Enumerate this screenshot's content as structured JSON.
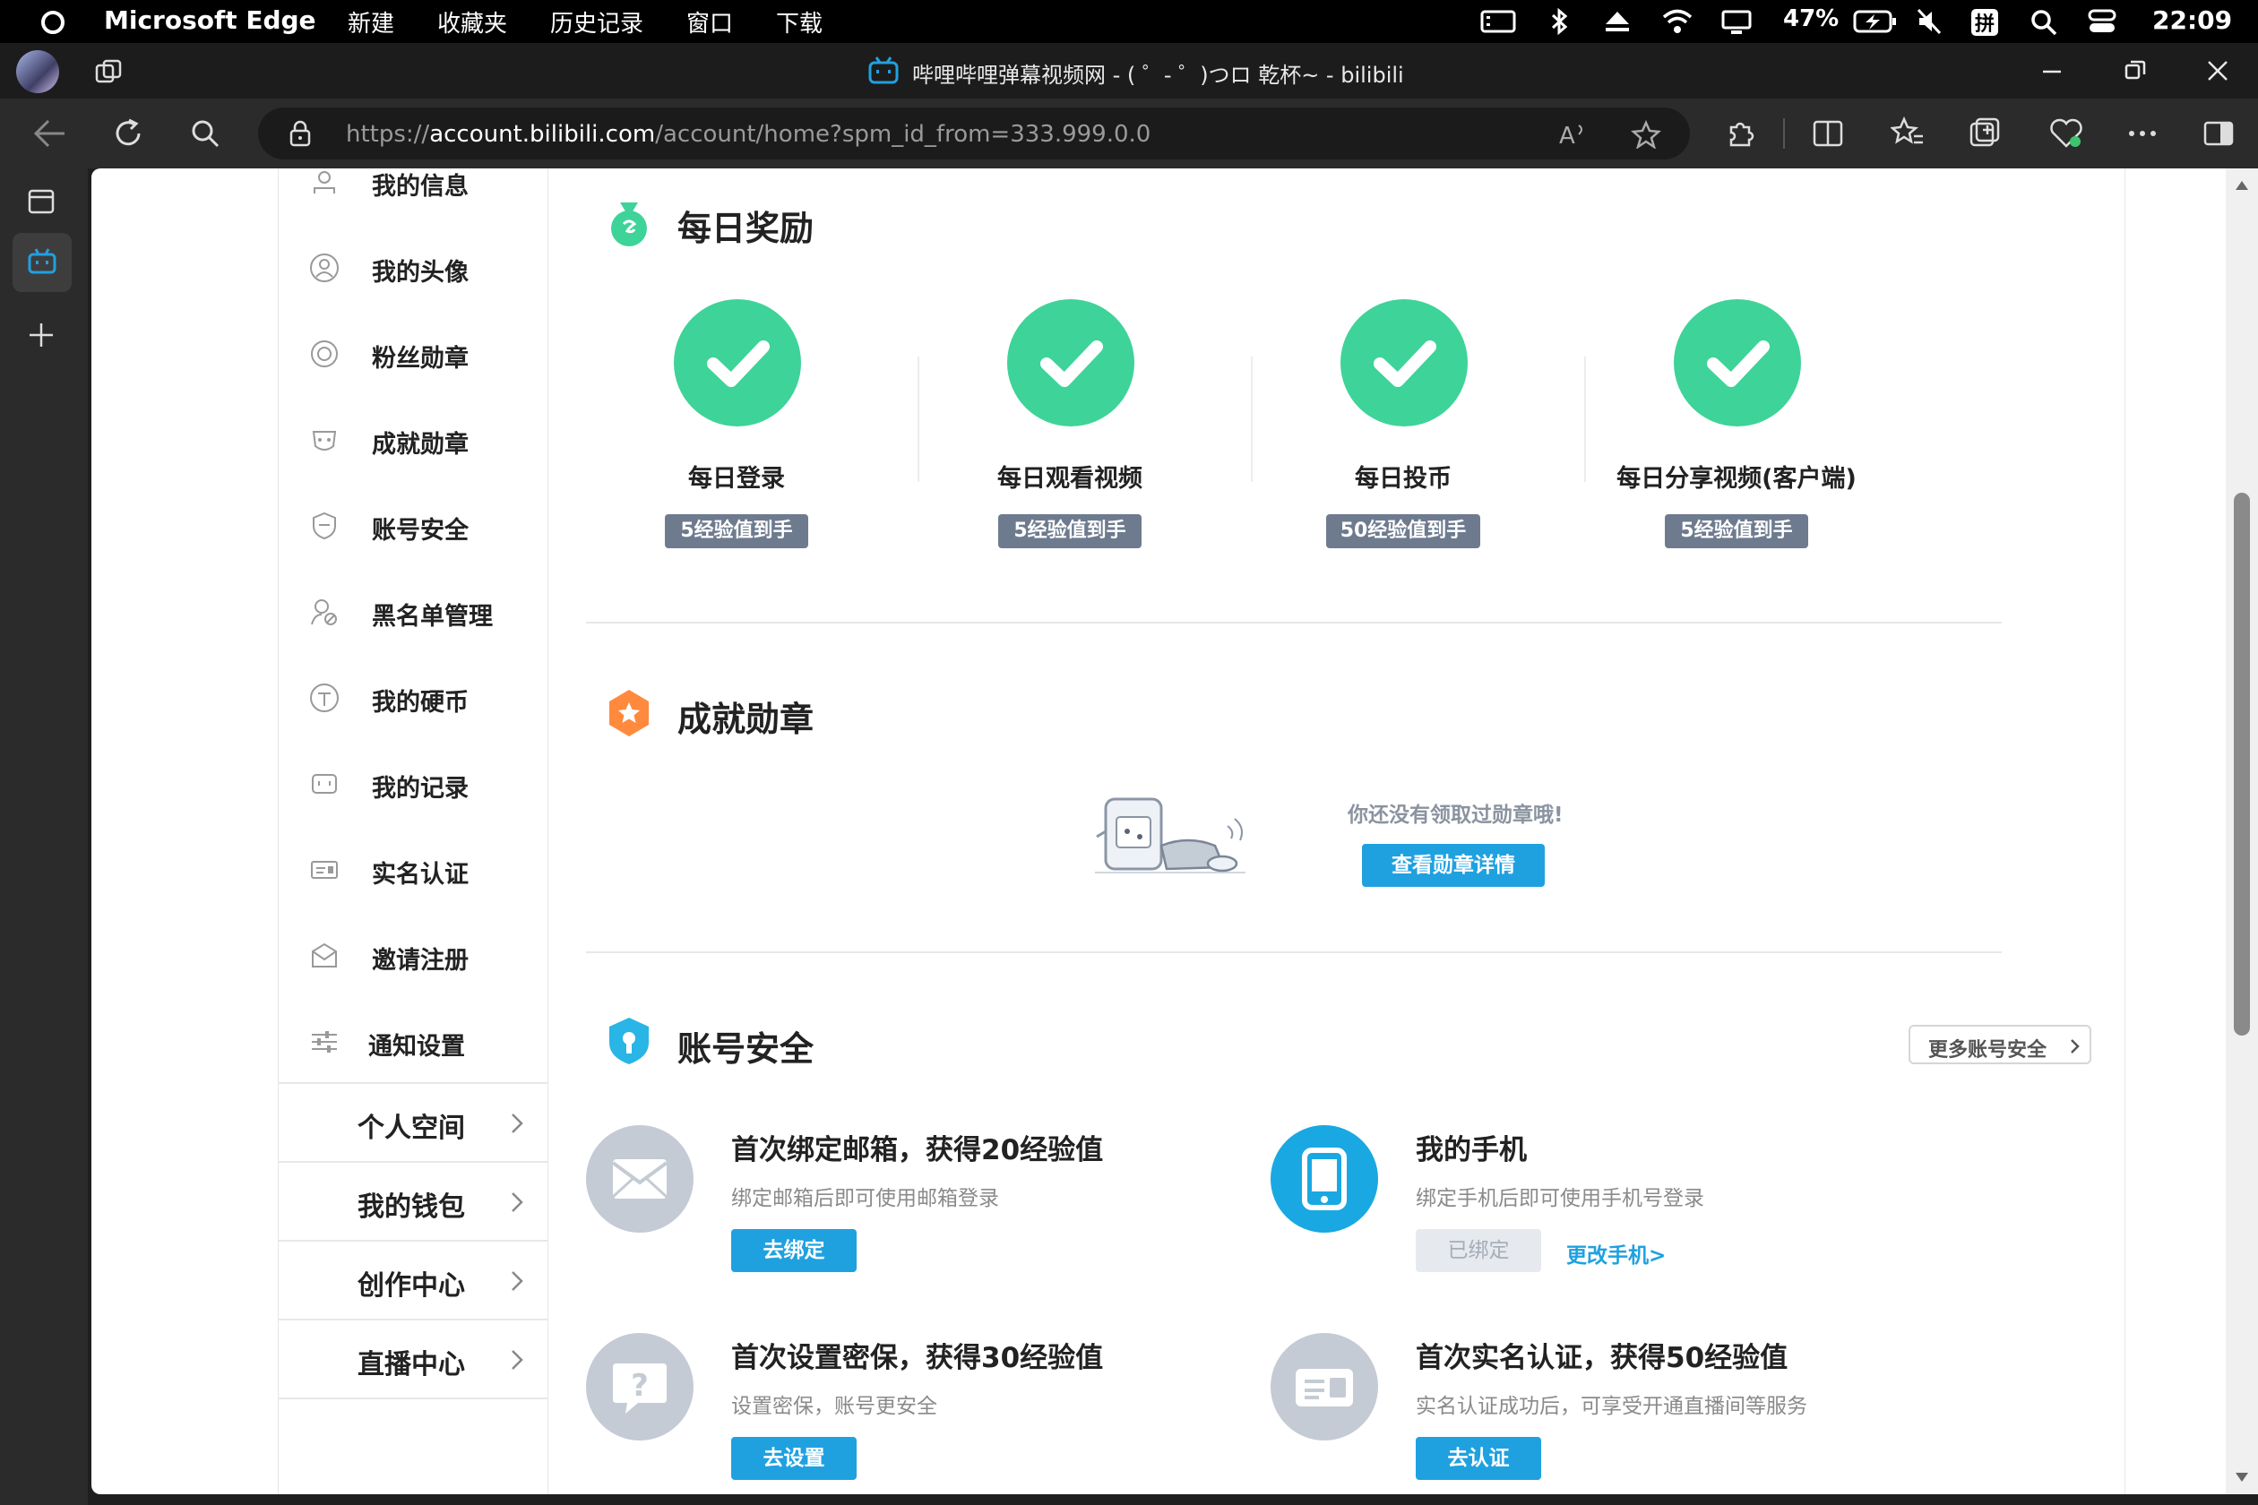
{
  "menubar": {
    "app_name": "Microsoft Edge",
    "items": [
      "新建",
      "收藏夹",
      "历史记录",
      "窗口",
      "下载"
    ],
    "battery": "47%",
    "time": "22:09"
  },
  "window": {
    "tab_title": "哔哩哔哩弹幕视频网 - ( ゜- ゜)つロ 乾杯~ - bilibili"
  },
  "address": {
    "url_prefix": "https://",
    "url_host": "account.bilibili.com",
    "url_path": "/account/home?spm_id_from=333.999.0.0"
  },
  "sidebar": {
    "items": [
      {
        "label": "我的信息",
        "icon": "user-info-icon"
      },
      {
        "label": "我的头像",
        "icon": "avatar-icon"
      },
      {
        "label": "粉丝勋章",
        "icon": "fan-medal-icon"
      },
      {
        "label": "成就勋章",
        "icon": "achievement-icon"
      },
      {
        "label": "账号安全",
        "icon": "shield-icon"
      },
      {
        "label": "黑名单管理",
        "icon": "blacklist-icon"
      },
      {
        "label": "我的硬币",
        "icon": "coin-icon"
      },
      {
        "label": "我的记录",
        "icon": "record-icon"
      },
      {
        "label": "实名认证",
        "icon": "id-card-icon"
      },
      {
        "label": "邀请注册",
        "icon": "invite-icon"
      },
      {
        "label": "通知设置",
        "icon": "settings-sliders-icon"
      }
    ],
    "links": [
      "个人空间",
      "我的钱包",
      "创作中心",
      "直播中心"
    ]
  },
  "daily": {
    "title": "每日奖励",
    "rewards": [
      {
        "name": "每日登录",
        "badge": "5经验值到手"
      },
      {
        "name": "每日观看视频",
        "badge": "5经验值到手"
      },
      {
        "name": "每日投币",
        "badge": "50经验值到手"
      },
      {
        "name": "每日分享视频(客户端)",
        "badge": "5经验值到手"
      }
    ]
  },
  "achievement": {
    "title": "成就勋章",
    "empty_text": "你还没有领取过勋章哦!",
    "button": "查看勋章详情"
  },
  "security": {
    "title": "账号安全",
    "more": "更多账号安全",
    "rows": [
      {
        "title": "首次绑定邮箱，获得20经验值",
        "desc": "绑定邮箱后即可使用邮箱登录",
        "button": "去绑定"
      },
      {
        "title": "我的手机",
        "desc": "绑定手机后即可使用手机号登录",
        "button": "已绑定",
        "link": "更改手机>"
      },
      {
        "title": "首次设置密保，获得30经验值",
        "desc": "设置密保，账号更安全",
        "button": "去设置"
      },
      {
        "title": "首次实名认证，获得50经验值",
        "desc": "实名认证成功后，可享受开通直播间等服务",
        "button": "去认证"
      }
    ]
  },
  "colors": {
    "accent_green": "#3ed399",
    "accent_blue": "#1fa1e0",
    "badge_gray": "#6e7b8f"
  }
}
